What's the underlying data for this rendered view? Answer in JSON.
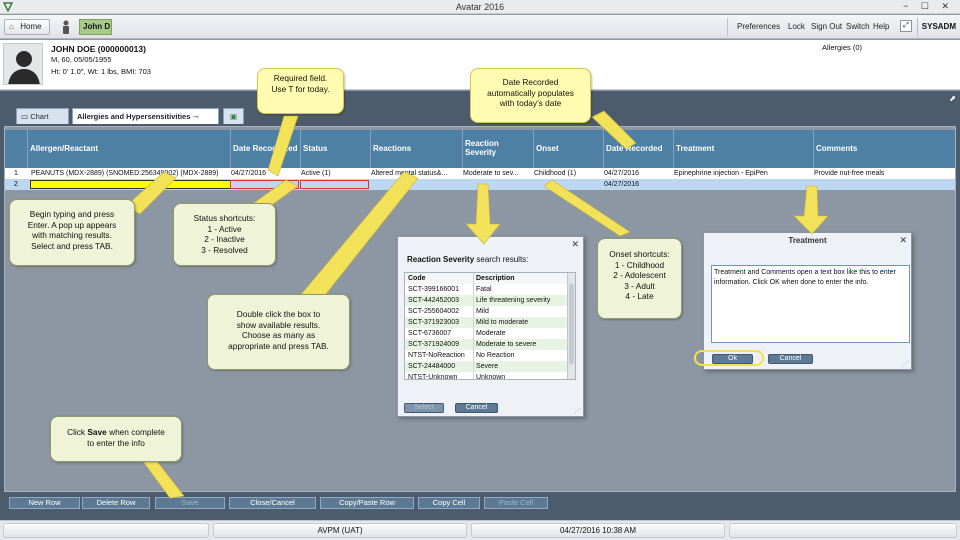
{
  "window": {
    "title": "Avatar 2016",
    "controls": "− ☐ ✕"
  },
  "toolbar": {
    "home_label": "Home",
    "client_label": "John D",
    "links": [
      "Preferences",
      "Lock",
      "Sign Out",
      "Switch",
      "Help"
    ],
    "user": "SYSADM"
  },
  "patient": {
    "name": "JOHN DOE (000000013)",
    "line1": "M, 60, 05/05/1955",
    "line2": "Ht: 0' 1.0\", Wt: 1 lbs, BMI: 703",
    "allergies": "Allergies (0)"
  },
  "tabs": {
    "chart": "Chart",
    "allergies": "Allergies and Hypersensitivities"
  },
  "grid": {
    "columns": [
      "Allergen/Reactant",
      "Date Recognized",
      "Status",
      "Reactions",
      "Reaction Severity",
      "Onset",
      "Date Recorded",
      "Treatment",
      "Comments"
    ],
    "rows": [
      {
        "num": "1",
        "allergen": "PEANUTS (MDX-2889) (SNOMED:256349002) (MDX-2889)",
        "date_recognized": "04/27/2016",
        "status": "Active (1)",
        "reactions": "Altered mental status&...",
        "severity": "Moderate to sev...",
        "onset": "Childhood (1)",
        "date_recorded": "04/27/2016",
        "treatment": "Epinephrine injection - EpiPen",
        "comments": "Provide nut-free meals"
      },
      {
        "num": "2",
        "allergen": "",
        "date_recognized": "",
        "status": "",
        "reactions": "",
        "severity": "",
        "onset": "",
        "date_recorded": "04/27/2016",
        "treatment": "",
        "comments": ""
      }
    ]
  },
  "buttons": [
    "New Row",
    "Delete Row",
    "Save",
    "Close/Cancel",
    "Copy/Paste Row",
    "Copy Cell",
    "Paste Cell"
  ],
  "status_bar": {
    "env": "AVPM (UAT)",
    "datetime": "04/27/2016 10:38 AM"
  },
  "severity_dialog": {
    "heading_bold": "Reaction Severity",
    "heading_rest": " search results:",
    "col_code": "Code",
    "col_desc": "Description",
    "rows": [
      {
        "code": "SCT-399166001",
        "desc": "Fatal"
      },
      {
        "code": "SCT-442452003",
        "desc": "Life threatening severity"
      },
      {
        "code": "SCT-255604002",
        "desc": "Mild"
      },
      {
        "code": "SCT-371923003",
        "desc": "Mild to moderate"
      },
      {
        "code": "SCT-6736007",
        "desc": "Moderate"
      },
      {
        "code": "SCT-371924009",
        "desc": "Moderate to severe"
      },
      {
        "code": "NTST-NoReaction",
        "desc": "No Reaction"
      },
      {
        "code": "SCT-24484000",
        "desc": "Severe"
      },
      {
        "code": "NTST-Unknown",
        "desc": "Unknown"
      }
    ],
    "select_label": "Select",
    "cancel_label": "Cancel"
  },
  "treatment_dialog": {
    "title": "Treatment",
    "text": "Treatment and Comments open a text box like this to enter information.  Click OK when done to enter the info.",
    "ok_label": "Ok",
    "cancel_label": "Cancel"
  },
  "callouts": {
    "required": "Required field.\nUse T for today.",
    "date_recorded": "Date Recorded\nautomatically populates\nwith today's date",
    "begin_typing": "Begin typing and press\nEnter.  A pop up appears\nwith matching results.\nSelect and press TAB.",
    "status_shortcuts": "Status shortcuts:\n1 - Active\n2 - Inactive\n3 - Resolved",
    "double_click": "Double click the box to\nshow available results.\nChoose as many as\nappropriate and press TAB.",
    "onset_shortcuts": "Onset shortcuts:\n1 - Childhood\n2 - Adolescent\n3 - Adult\n4 - Late",
    "save_pre": "Click ",
    "save_bold": "Save",
    "save_post": " when complete\nto enter the info"
  },
  "colors": {
    "header_blue": "#4e80a6",
    "selected_row": "#bcd7f1",
    "required_yellow": "#ffff00",
    "callout_green": "#eff3d8",
    "callout_yellow": "#fffcb2",
    "arrow_yellow": "#f2e25a"
  }
}
